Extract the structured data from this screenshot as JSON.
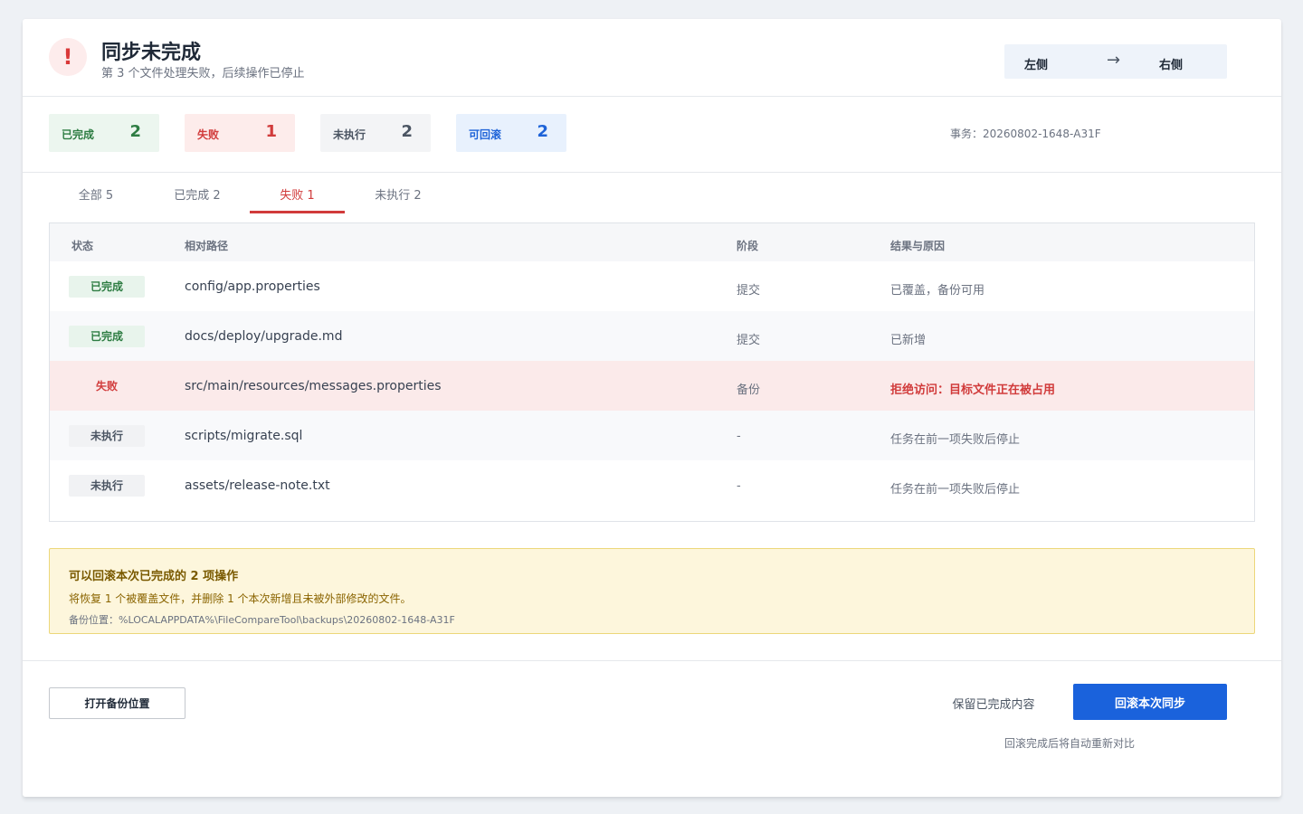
{
  "header": {
    "title": "同步未完成",
    "subtitle": "第 3 个文件处理失败，后续操作已停止",
    "direction": {
      "left": "左侧",
      "arrow": "→",
      "right": "右侧"
    }
  },
  "summary": {
    "done": {
      "label": "已完成",
      "count": "2"
    },
    "failed": {
      "label": "失败",
      "count": "1"
    },
    "pending": {
      "label": "未执行",
      "count": "2"
    },
    "rollbackable": {
      "label": "可回滚",
      "count": "2"
    },
    "transaction": "事务：20260802-1648-A31F"
  },
  "tabs": [
    {
      "label": "全部 5",
      "active": false
    },
    {
      "label": "已完成 2",
      "active": false
    },
    {
      "label": "失败 1",
      "active": true
    },
    {
      "label": "未执行 2",
      "active": false
    }
  ],
  "table": {
    "headers": {
      "status": "状态",
      "path": "相对路径",
      "stage": "阶段",
      "result": "结果与原因"
    },
    "rows": [
      {
        "status": "已完成",
        "path": "config/app.properties",
        "stage": "提交",
        "result": "已覆盖，备份可用"
      },
      {
        "status": "已完成",
        "path": "docs/deploy/upgrade.md",
        "stage": "提交",
        "result": "已新增"
      },
      {
        "status": "失败",
        "path": "src/main/resources/messages.properties",
        "stage": "备份",
        "result": "拒绝访问：目标文件正在被占用"
      },
      {
        "status": "未执行",
        "path": "scripts/migrate.sql",
        "stage": "-",
        "result": "任务在前一项失败后停止"
      },
      {
        "status": "未执行",
        "path": "assets/release-note.txt",
        "stage": "-",
        "result": "任务在前一项失败后停止"
      }
    ]
  },
  "notice": {
    "title": "可以回滚本次已完成的 2 项操作",
    "description": "将恢复 1 个被覆盖文件，并删除 1 个本次新增且未被外部修改的文件。",
    "backup_path": "备份位置：%LOCALAPPDATA%\\FileCompareTool\\backups\\20260802-1648-A31F"
  },
  "footer": {
    "open_backup": "打开备份位置",
    "keep_done": "保留已完成内容",
    "rollback": "回滚本次同步",
    "hint": "回滚完成后将自动重新对比"
  }
}
